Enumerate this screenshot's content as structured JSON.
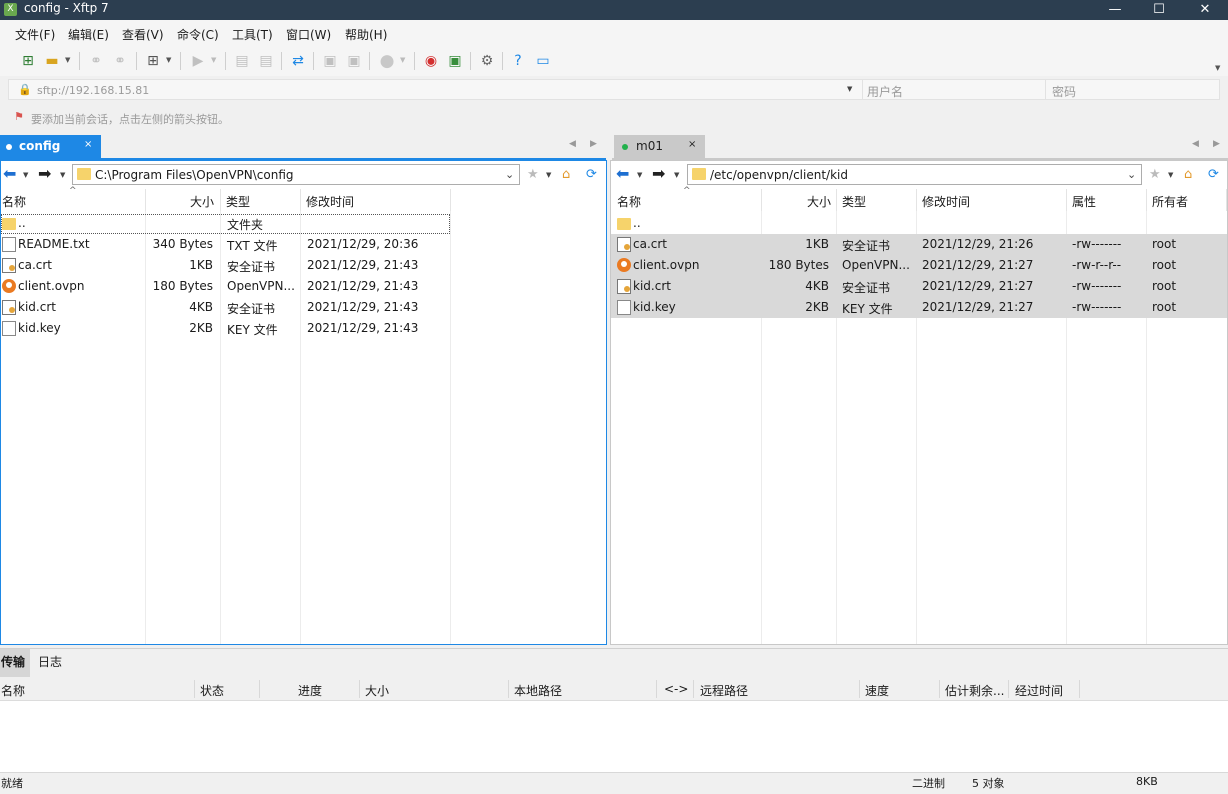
{
  "window": {
    "title": "config - Xftp 7",
    "app_icon": "xftp-icon"
  },
  "menu": [
    "文件(F)",
    "编辑(E)",
    "查看(V)",
    "命令(C)",
    "工具(T)",
    "窗口(W)",
    "帮助(H)"
  ],
  "address": {
    "url": "sftp://192.168.15.81",
    "username_placeholder": "用户名",
    "password_placeholder": "密码"
  },
  "hint": "要添加当前会话，点击左侧的箭头按钮。",
  "left_tab": {
    "label": "config",
    "close": "×",
    "dot_color": "#1e88e5"
  },
  "right_tab": {
    "label": "m01",
    "close": "×",
    "dot_color": "#22b14c"
  },
  "left": {
    "path": "C:\\Program Files\\OpenVPN\\config",
    "columns": [
      "名称",
      "大小",
      "类型",
      "修改时间"
    ],
    "rows": [
      {
        "name": "..",
        "size": "",
        "type": "文件夹",
        "modified": "",
        "icon": "folder"
      },
      {
        "name": "README.txt",
        "size": "340 Bytes",
        "type": "TXT 文件",
        "modified": "2021/12/29, 20:36",
        "icon": "txt"
      },
      {
        "name": "ca.crt",
        "size": "1KB",
        "type": "安全证书",
        "modified": "2021/12/29, 21:43",
        "icon": "cert"
      },
      {
        "name": "client.ovpn",
        "size": "180 Bytes",
        "type": "OpenVPN...",
        "modified": "2021/12/29, 21:43",
        "icon": "vpn"
      },
      {
        "name": "kid.crt",
        "size": "4KB",
        "type": "安全证书",
        "modified": "2021/12/29, 21:43",
        "icon": "cert"
      },
      {
        "name": "kid.key",
        "size": "2KB",
        "type": "KEY 文件",
        "modified": "2021/12/29, 21:43",
        "icon": "key"
      }
    ]
  },
  "right": {
    "path": "/etc/openvpn/client/kid",
    "columns": [
      "名称",
      "大小",
      "类型",
      "修改时间",
      "属性",
      "所有者"
    ],
    "rows": [
      {
        "name": "..",
        "size": "",
        "type": "",
        "modified": "",
        "attr": "",
        "owner": "",
        "icon": "folder",
        "selected": false
      },
      {
        "name": "ca.crt",
        "size": "1KB",
        "type": "安全证书",
        "modified": "2021/12/29, 21:26",
        "attr": "-rw-------",
        "owner": "root",
        "icon": "cert",
        "selected": true
      },
      {
        "name": "client.ovpn",
        "size": "180 Bytes",
        "type": "OpenVPN...",
        "modified": "2021/12/29, 21:27",
        "attr": "-rw-r--r--",
        "owner": "root",
        "icon": "vpn",
        "selected": true
      },
      {
        "name": "kid.crt",
        "size": "4KB",
        "type": "安全证书",
        "modified": "2021/12/29, 21:27",
        "attr": "-rw-------",
        "owner": "root",
        "icon": "cert",
        "selected": true
      },
      {
        "name": "kid.key",
        "size": "2KB",
        "type": "KEY 文件",
        "modified": "2021/12/29, 21:27",
        "attr": "-rw-------",
        "owner": "root",
        "icon": "key",
        "selected": true
      }
    ]
  },
  "transfer": {
    "tabs": [
      "传输",
      "日志"
    ],
    "columns": [
      "名称",
      "状态",
      "进度",
      "大小",
      "本地路径",
      "<->",
      "远程路径",
      "速度",
      "估计剩余...",
      "经过时间"
    ]
  },
  "status": {
    "left": "就绪",
    "mode": "二进制",
    "count": "5 对象",
    "size": "8KB"
  },
  "colors": {
    "accent": "#1e88e5",
    "titlebar": "#2c3e50",
    "selection": "#d9d9d9"
  }
}
